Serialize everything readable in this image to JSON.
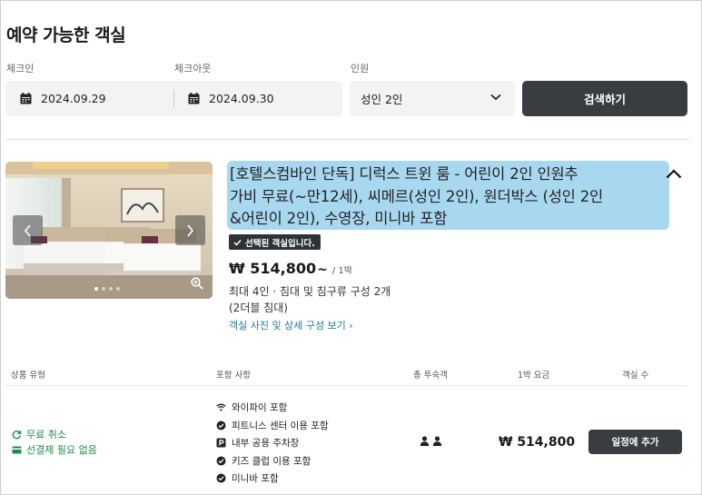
{
  "page": {
    "title": "예약 가능한 객실"
  },
  "search": {
    "checkin_label": "체크인",
    "checkout_label": "체크아웃",
    "guests_label": "인원",
    "checkin_value": "2024.09.29",
    "checkout_value": "2024.09.30",
    "guests_value": "성인 2인",
    "search_button": "검색하기"
  },
  "room": {
    "name": "[호텔스컴바인 단독] 디럭스 트윈 룸 - 어린이 2인 인원추가비 무료(~만12세), 씨메르(성인 2인), 원더박스 (성인 2인&어린이 2인), 수영장, 미니바 포함",
    "name_lines": [
      "[호텔스컴바인 단독] 디럭스 트윈 룸 - 어린이 2인 인원추",
      "가비 무료(~만12세), 씨메르(성인 2인), 원더박스 (성인 2인",
      "&어린이 2인), 수영장, 미니바 포함"
    ],
    "selected_badge": "선택된 객실입니다.",
    "price": "₩ 514,800",
    "price_tilde": "~",
    "price_unit": "/ 1박",
    "capacity": "최대 4인 · 침대 및 침구류 구성 2개",
    "bed_info": "(2더블 침대)",
    "detail_link": "객실 사진 및 상세 구성 보기 ›",
    "photo_count": 4,
    "photo_active_index": 0
  },
  "table": {
    "headers": [
      "상품 유형",
      "포함 사항",
      "총 투숙객",
      "1박 요금",
      "객실 수"
    ],
    "row": {
      "cancel": "무료 취소",
      "prepay": "선결제 필요 없음",
      "inclusions": [
        {
          "icon": "wifi-icon",
          "text": "와이파이 포함"
        },
        {
          "icon": "check-circle-icon",
          "text": "피트니스 센터 이용 포함"
        },
        {
          "icon": "parking-icon",
          "text": "내부 공용 주차장"
        },
        {
          "icon": "check-circle-icon",
          "text": "키즈 클럽 이용 포함"
        },
        {
          "icon": "check-circle-icon",
          "text": "미니바 포함"
        }
      ],
      "guests": 2,
      "price": "₩ 514,800",
      "add_button": "일정에 추가"
    }
  },
  "colors": {
    "dark_button": "#383d42",
    "highlight": "#a8d8f0",
    "green": "#1e8a4a",
    "link": "#1f7a8c"
  }
}
